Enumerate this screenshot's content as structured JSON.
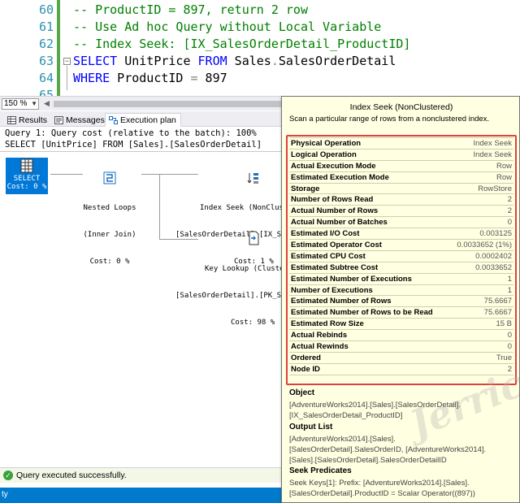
{
  "editor": {
    "lines": [
      {
        "num": "60",
        "text": "-- ProductID = 897, return 2 row"
      },
      {
        "num": "61",
        "text": "-- Use Ad hoc Query without Local Variable"
      },
      {
        "num": "62",
        "text": "-- Index Seek: [IX_SalesOrderDetail_ProductID]"
      },
      {
        "num": "63",
        "kw1": "SELECT",
        "id1": " UnitPrice ",
        "kw2": "FROM",
        "id2": " Sales",
        "op1": ".",
        "id3": "SalesOrderDetail"
      },
      {
        "num": "64",
        "kw1": "WHERE",
        "id1": " ProductID ",
        "op1": "=",
        "id2": " 897"
      },
      {
        "num": "65",
        "text": ""
      }
    ],
    "colors": {
      "comment": "#008000",
      "keyword": "#0000ff",
      "line_number": "#2b91af"
    }
  },
  "zoom": {
    "value": "150 %"
  },
  "tabs": [
    {
      "label": "Results",
      "icon": "grid-icon"
    },
    {
      "label": "Messages",
      "icon": "messages-icon"
    },
    {
      "label": "Execution plan",
      "icon": "execution-plan-icon",
      "active": true
    }
  ],
  "plan": {
    "header_line1": "Query 1: Query cost (relative to the batch): 100%",
    "header_line2": "SELECT [UnitPrice] FROM [Sales].[SalesOrderDetail]",
    "select_node": {
      "label": "SELECT",
      "cost": "Cost: 0 %"
    },
    "nested_loops": {
      "line1": "Nested Loops",
      "line2": "(Inner Join)",
      "cost": "Cost: 0 %"
    },
    "index_seek": {
      "line1": "Index Seek (NonClust",
      "line2": "[SalesOrderDetail].[IX_Sa",
      "cost": "Cost: 1 %"
    },
    "key_lookup": {
      "line1": "Key Lookup (Cluste",
      "line2": "[SalesOrderDetail].[PK_Sa",
      "cost": "Cost: 98 %"
    }
  },
  "tooltip": {
    "title": "Index Seek (NonClustered)",
    "description": "Scan a particular range of rows from a nonclustered index.",
    "properties": [
      {
        "label": "Physical Operation",
        "value": "Index Seek"
      },
      {
        "label": "Logical Operation",
        "value": "Index Seek"
      },
      {
        "label": "Actual Execution Mode",
        "value": "Row"
      },
      {
        "label": "Estimated Execution Mode",
        "value": "Row"
      },
      {
        "label": "Storage",
        "value": "RowStore"
      },
      {
        "label": "Number of Rows Read",
        "value": "2"
      },
      {
        "label": "Actual Number of Rows",
        "value": "2"
      },
      {
        "label": "Actual Number of Batches",
        "value": "0"
      },
      {
        "label": "Estimated I/O Cost",
        "value": "0.003125"
      },
      {
        "label": "Estimated Operator Cost",
        "value": "0.0033652 (1%)"
      },
      {
        "label": "Estimated CPU Cost",
        "value": "0.0002402"
      },
      {
        "label": "Estimated Subtree Cost",
        "value": "0.0033652"
      },
      {
        "label": "Estimated Number of Executions",
        "value": "1"
      },
      {
        "label": "Number of Executions",
        "value": "1"
      },
      {
        "label": "Estimated Number of Rows",
        "value": "75.6667"
      },
      {
        "label": "Estimated Number of Rows to be Read",
        "value": "75.6667"
      },
      {
        "label": "Estimated Row Size",
        "value": "15 B"
      },
      {
        "label": "Actual Rebinds",
        "value": "0"
      },
      {
        "label": "Actual Rewinds",
        "value": "0"
      },
      {
        "label": "Ordered",
        "value": "True"
      },
      {
        "label": "Node ID",
        "value": "2"
      }
    ],
    "object_title": "Object",
    "object_line1": "[AdventureWorks2014].[Sales].[SalesOrderDetail].",
    "object_line2": "[IX_SalesOrderDetail_ProductID]",
    "output_title": "Output List",
    "output_line1": "[AdventureWorks2014].[Sales].",
    "output_line2": "[SalesOrderDetail].SalesOrderID, [AdventureWorks2014].",
    "output_line3": "[Sales].[SalesOrderDetail].SalesOrderDetailID",
    "seek_title": "Seek Predicates",
    "seek_line1": "Seek Keys[1]: Prefix: [AdventureWorks2014].[Sales].",
    "seek_line2": "[SalesOrderDetail].ProductID = Scalar Operator((897))",
    "highlight_color": "#e04040",
    "watermark": "Jerrick"
  },
  "status": {
    "message": "Query executed successfully.",
    "bar_text": "ty"
  }
}
